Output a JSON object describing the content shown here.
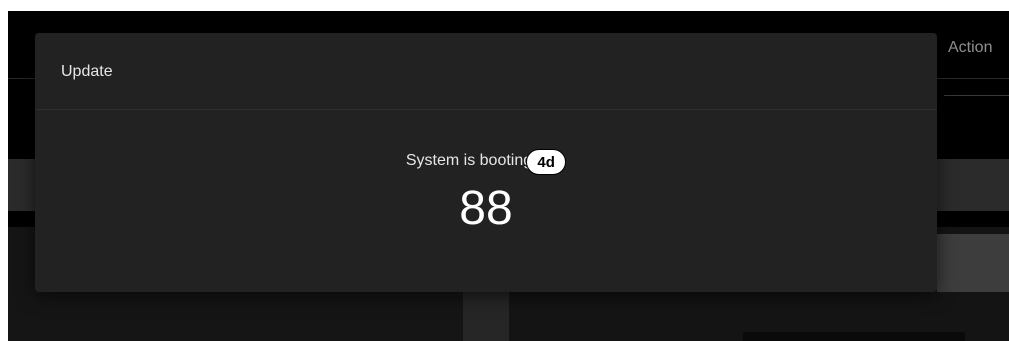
{
  "background": {
    "actions_label": "Action"
  },
  "dialog": {
    "title": "Update",
    "status_text": "System is booting",
    "badge": "4d",
    "countdown": "88"
  }
}
